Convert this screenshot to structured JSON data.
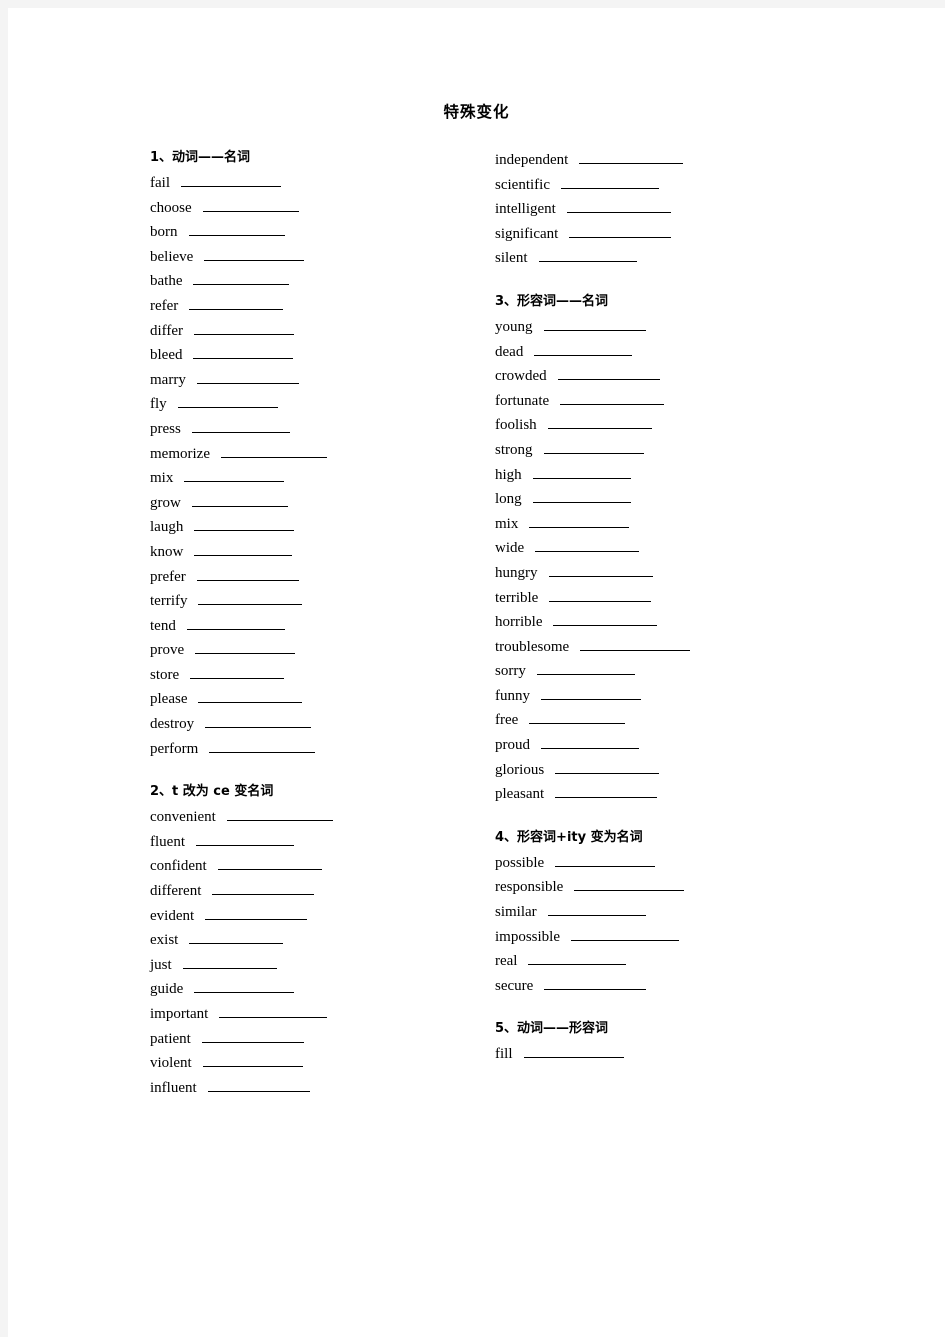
{
  "document": {
    "title": "特殊变化"
  },
  "columns": {
    "left": [
      {
        "heading": "1、动词——名词",
        "spaced": false,
        "entries": [
          "fail",
          "choose",
          "born",
          "believe",
          "bathe",
          "refer",
          "differ",
          "bleed",
          "marry",
          "fly",
          "press",
          "memorize",
          "mix",
          "grow",
          "laugh",
          "know",
          "prefer",
          "terrify",
          "tend",
          "prove",
          "store",
          "please",
          "destroy",
          "perform"
        ]
      },
      {
        "heading": "2、t 改为 ce 变名词",
        "spaced": true,
        "entries": [
          "convenient",
          "fluent",
          "confident",
          "different",
          "evident",
          "exist",
          "just",
          "guide",
          "important",
          "patient",
          "violent",
          "influent"
        ]
      }
    ],
    "right": [
      {
        "heading": "",
        "spaced": false,
        "entries": [
          "independent",
          "scientific",
          "intelligent",
          "significant",
          "silent"
        ]
      },
      {
        "heading": "3、形容词——名词",
        "spaced": true,
        "entries": [
          "young",
          "dead",
          "crowded",
          "fortunate",
          "foolish",
          "strong",
          "high",
          "long",
          "mix",
          "wide",
          "hungry",
          "terrible",
          "horrible",
          "troublesome",
          "sorry",
          "funny",
          "free",
          "proud",
          "glorious",
          "pleasant"
        ]
      },
      {
        "heading": "4、形容词+ity 变为名词",
        "spaced": true,
        "entries": [
          "possible",
          "responsible",
          "similar",
          "impossible",
          "real",
          "secure"
        ]
      },
      {
        "heading": "5、动词——形容词",
        "spaced": true,
        "entries": [
          "fill"
        ]
      }
    ]
  },
  "blank_widths": {
    "fail": 100,
    "choose": 96,
    "born": 96,
    "believe": 100,
    "bathe": 96,
    "refer": 94,
    "differ": 100,
    "bleed": 100,
    "marry": 102,
    "fly": 100,
    "press": 98,
    "memorize": 106,
    "mix": 100,
    "grow": 96,
    "laugh": 100,
    "know": 98,
    "prefer": 102,
    "terrify": 104,
    "tend": 98,
    "prove": 100,
    "store": 94,
    "please": 104,
    "destroy": 106,
    "perform": 106,
    "convenient": 106,
    "fluent": 98,
    "confident": 104,
    "different": 102,
    "evident": 102,
    "exist": 94,
    "just": 94,
    "guide": 100,
    "important": 108,
    "patient": 102,
    "violent": 100,
    "influent": 102,
    "independent": 104,
    "scientific": 98,
    "intelligent": 104,
    "significant": 102,
    "silent": 98,
    "young": 102,
    "dead": 98,
    "crowded": 102,
    "fortunate": 104,
    "foolish": 104,
    "strong": 100,
    "high": 98,
    "long": 98,
    "wide": 104,
    "hungry": 104,
    "terrible": 102,
    "horrible": 104,
    "troublesome": 110,
    "sorry": 98,
    "funny": 100,
    "free": 96,
    "proud": 98,
    "glorious": 104,
    "pleasant": 102,
    "possible": 100,
    "responsible": 110,
    "similar": 98,
    "impossible": 108,
    "real": 98,
    "secure": 102,
    "fill": 100
  }
}
